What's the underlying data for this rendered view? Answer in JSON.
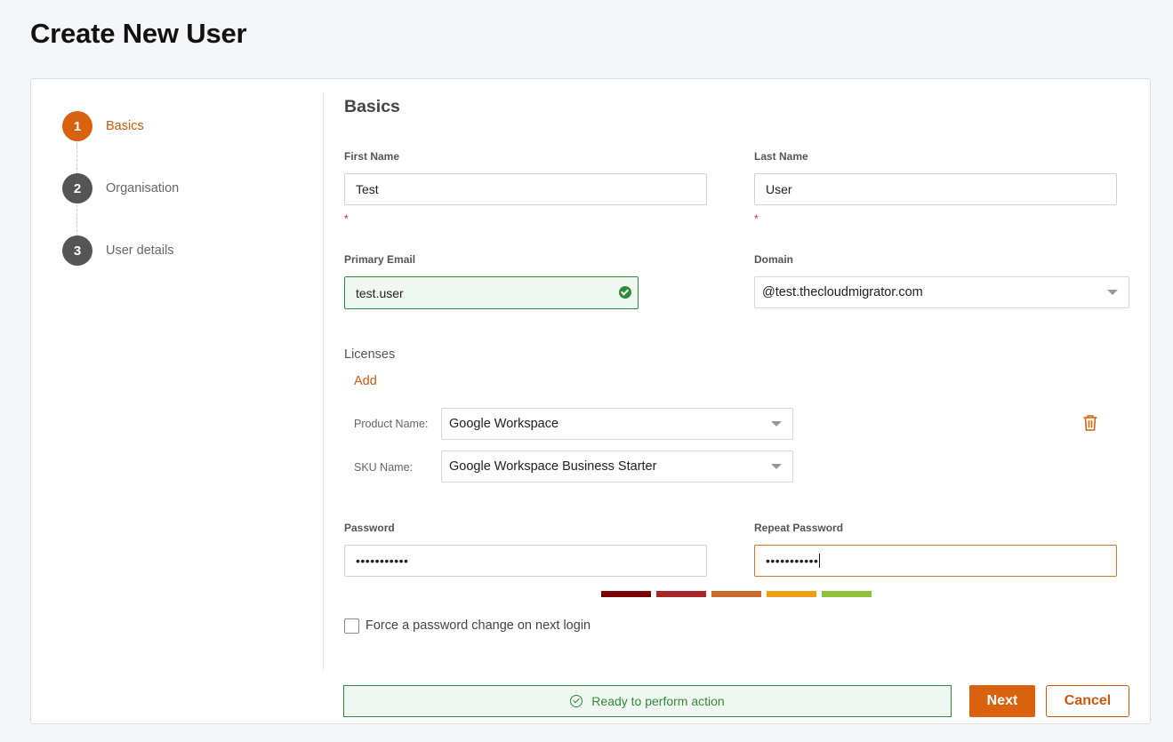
{
  "page": {
    "title": "Create New User"
  },
  "stepper": {
    "steps": [
      {
        "number": "1",
        "label": "Basics",
        "active": true
      },
      {
        "number": "2",
        "label": "Organisation",
        "active": false
      },
      {
        "number": "3",
        "label": "User details",
        "active": false
      }
    ]
  },
  "form": {
    "section_title": "Basics",
    "first_name": {
      "label": "First Name",
      "value": "Test",
      "required_mark": "*"
    },
    "last_name": {
      "label": "Last Name",
      "value": "User",
      "required_mark": "*"
    },
    "primary_email": {
      "label": "Primary Email",
      "value": "test.user"
    },
    "domain": {
      "label": "Domain",
      "value": "@test.thecloudmigrator.com"
    },
    "licenses": {
      "label": "Licenses",
      "add_label": "Add",
      "product_name_label": "Product Name:",
      "product_name_value": "Google Workspace",
      "sku_name_label": "SKU Name:",
      "sku_name_value": "Google Workspace Business Starter"
    },
    "password": {
      "label": "Password",
      "value": "•••••••••••"
    },
    "repeat_password": {
      "label": "Repeat Password",
      "value": "•••••••••••"
    },
    "strength_colors": [
      "#7a0000",
      "#a8262a",
      "#c86a2a",
      "#f0a018",
      "#8cc43a"
    ],
    "force_change": {
      "label": "Force a password change on next login",
      "checked": false
    }
  },
  "footer": {
    "status_text": "Ready to perform action",
    "next_label": "Next",
    "cancel_label": "Cancel"
  },
  "colors": {
    "accent": "#d9620f",
    "success": "#2e8b3a",
    "error": "#e02424"
  }
}
